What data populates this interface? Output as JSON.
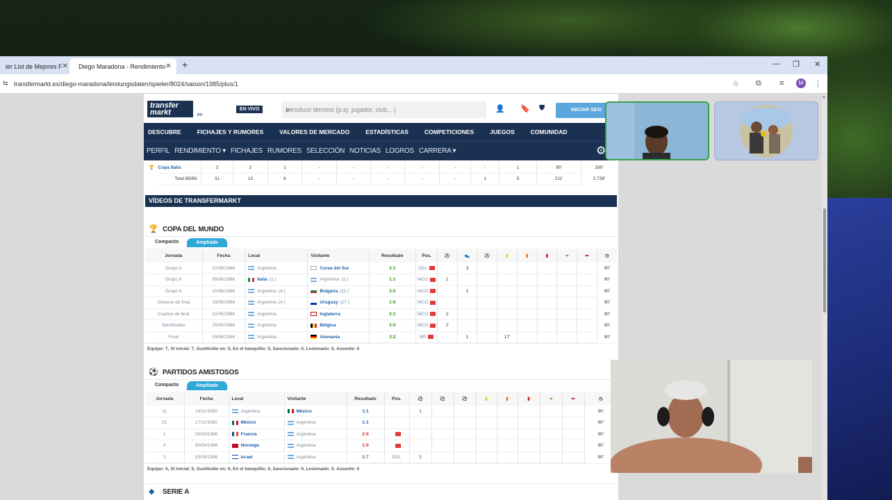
{
  "browser": {
    "tabs": [
      {
        "label": "ier List de Mejores F"
      },
      {
        "label": "Diego Maradona - Rendimiento"
      }
    ],
    "url": "transfermarkt.es/diego-maradona/leistungsdaten/spieler/8024/saison/1985/plus/1",
    "profile_initial": "M"
  },
  "site": {
    "logo_line1": "transfer",
    "logo_line2": "markt",
    "logo_domain": ".es",
    "live_label": "EN VIVO",
    "search_placeholder": "Introducir término (p.ej. jugador, club,...)",
    "login_label": "INICIAR SESI",
    "main_nav": [
      "DESCUBRE",
      "FICHAJES Y RUMORES",
      "VALORES DE MERCADO",
      "ESTADÍSTICAS",
      "COMPETICIONES",
      "JUEGOS",
      "COMUNIDAD"
    ],
    "sub_nav": [
      "PERFIL",
      "RENDIMIENTO ▾",
      "FICHAJES",
      "RUMORES",
      "SELECCIÓN",
      "NOTICIAS",
      "LOGROS",
      "CARRERA ▾"
    ]
  },
  "summary": {
    "rows": [
      {
        "comp": "Copa Italia",
        "cells": [
          "2",
          "2",
          "1",
          "-",
          "-",
          "-",
          "-",
          "-",
          "-",
          "1",
          "90'",
          "180'"
        ]
      },
      {
        "comp": "Total 85/86:",
        "cells": [
          "31",
          "13",
          "6",
          "-",
          "-",
          "-",
          "-",
          "-",
          "1",
          "5",
          "211'",
          "2.738'"
        ]
      }
    ]
  },
  "videos_title": "VÍDEOS DE TRANSFERMARKT",
  "world_cup": {
    "title": "COPA DEL MUNDO",
    "toggle_compact": "Compacto",
    "toggle_expanded": "Ampliado",
    "headers": [
      "Jornada",
      "Fecha",
      "Local",
      "Visitante",
      "Resultado",
      "Pos."
    ],
    "rows": [
      {
        "round": "Grupo A",
        "date": "02/06/1986",
        "home": "Argentina",
        "home_flag": "ar",
        "home_rank": "",
        "away": "Corea del Sur",
        "away_flag": "kr",
        "away_rank": "",
        "away_bold": true,
        "result": "3:1",
        "pos": "DEL",
        "goals": "",
        "assists": "3",
        "min": "90'"
      },
      {
        "round": "Grupo A",
        "date": "05/06/1986",
        "home": "Italia",
        "home_flag": "it",
        "home_rank": "(1.)",
        "home_bold": true,
        "away": "Argentina",
        "away_flag": "ar",
        "away_rank": "(2.)",
        "result": "1:1",
        "pos": "MCO",
        "goals": "1",
        "assists": "",
        "min": "90'"
      },
      {
        "round": "Grupo A",
        "date": "10/06/1986",
        "home": "Argentina",
        "home_flag": "ar",
        "home_rank": "(4.)",
        "away": "Bulgaria",
        "away_flag": "bg",
        "away_rank": "(11.)",
        "away_bold": true,
        "result": "2:0",
        "pos": "MCO",
        "goals": "",
        "assists": "1",
        "min": "90'"
      },
      {
        "round": "Octavos de final",
        "date": "16/06/1986",
        "home": "Argentina",
        "home_flag": "ar",
        "home_rank": "(4.)",
        "away": "Uruguay",
        "away_flag": "uy",
        "away_rank": "(17.)",
        "away_bold": true,
        "result": "1:0",
        "pos": "MCO",
        "goals": "",
        "assists": "",
        "min": "90'"
      },
      {
        "round": "Cuartos de final",
        "date": "22/06/1986",
        "home": "Argentina",
        "home_flag": "ar",
        "home_rank": "",
        "away": "Inglaterra",
        "away_flag": "en",
        "away_rank": "",
        "away_bold": true,
        "result": "2:1",
        "pos": "MCO",
        "goals": "2",
        "assists": "",
        "min": "90'"
      },
      {
        "round": "Semifinales",
        "date": "25/06/1986",
        "home": "Argentina",
        "home_flag": "ar",
        "home_rank": "",
        "away": "Bélgica",
        "away_flag": "be",
        "away_rank": "",
        "away_bold": true,
        "result": "2:0",
        "pos": "MCO",
        "goals": "2",
        "assists": "",
        "min": "90'"
      },
      {
        "round": "Final",
        "date": "29/06/1986",
        "home": "Argentina",
        "home_flag": "ar",
        "home_rank": "",
        "away": "Alemania",
        "away_flag": "de",
        "away_rank": "",
        "away_bold": true,
        "result": "3:2",
        "pos": "MP",
        "goals": "",
        "assists": "1",
        "yellow_min": "17'",
        "min": "90'"
      }
    ],
    "footer": "Equipo: 7, XI inicial: 7, Sustituido en: 0, En el banquillo: 0, Sancionado: 0, Lesionado: 0, Ausente: 0"
  },
  "friendlies": {
    "title": "PARTIDOS AMISTOSOS",
    "toggle_compact": "Compacto",
    "toggle_expanded": "Ampliado",
    "headers": [
      "Jornada",
      "Fecha",
      "Local",
      "Visitante",
      "Resultado",
      "Pos."
    ],
    "rows": [
      {
        "round": "11",
        "date": "14/11/1985",
        "home": "Argentina",
        "home_flag": "ar",
        "away": "México",
        "away_flag": "mx",
        "away_bold": true,
        "result": "1:1",
        "result_color": "blue",
        "pos": "",
        "goals": "1",
        "min": "90'"
      },
      {
        "round": "21",
        "date": "17/11/1985",
        "home": "México",
        "home_flag": "mx",
        "home_bold": true,
        "away": "Argentina",
        "away_flag": "ar",
        "result": "1:1",
        "result_color": "blue",
        "pos": "",
        "goals": "",
        "min": "90'"
      },
      {
        "round": "1",
        "date": "26/03/1986",
        "home": "Francia",
        "home_flag": "fr",
        "home_bold": true,
        "away": "Argentina",
        "away_flag": "ar",
        "result": "2:0",
        "result_color": "red",
        "pos": "flag",
        "goals": "",
        "min": "90'"
      },
      {
        "round": "4",
        "date": "30/04/1986",
        "home": "Noruega",
        "home_flag": "no",
        "home_bold": true,
        "away": "Argentina",
        "away_flag": "ar",
        "result": "1:0",
        "result_color": "red",
        "pos": "flag",
        "goals": "",
        "min": "90'"
      },
      {
        "round": "2",
        "date": "03/05/1986",
        "home": "Israel",
        "home_flag": "il",
        "home_bold": true,
        "away": "Argentina",
        "away_flag": "ar",
        "result": "2:7",
        "result_color": "green",
        "pos": "DEL",
        "goals": "2",
        "min": "90'"
      }
    ],
    "footer": "Equipo: 5, XI inicial: 5, Sustituido en: 0, En el banquillo: 0, Sancionado: 0, Lesionado: 0, Ausente: 0"
  },
  "serie_a_title": "SERIE A"
}
